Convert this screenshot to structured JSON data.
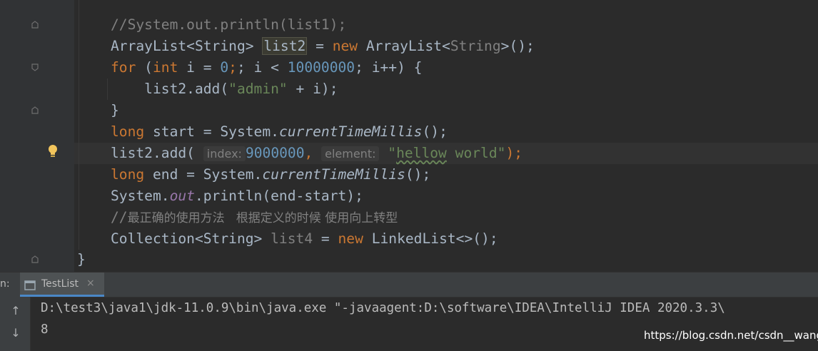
{
  "code": {
    "l1_comment": "//System.out.println(list1);",
    "l2_type": "ArrayList<String> ",
    "l2_var": "list2",
    "l2_eq": " = ",
    "l2_new": "new",
    "l2_cls": " ArrayList<",
    "l2_generic": "String",
    "l2_end": ">();",
    "l3_for": "for",
    "l3_a": " (",
    "l3_int": "int",
    "l3_b": " i = ",
    "l3_zero": "0",
    "l3_c": "; i < ",
    "l3_limit": "10000000",
    "l3_d": "; i++) {",
    "l4_a": "    list2.add(",
    "l4_str": "\"admin\"",
    "l4_b": " + i);",
    "l5_brace": "}",
    "l6_long": "long",
    "l6_a": " start = System.",
    "l6_method": "currentTimeMillis",
    "l6_b": "();",
    "l7_a": "list2.add(",
    "l7_hint_index": "index:",
    "l7_index_val": "9000000",
    "l7_comma": ", ",
    "l7_hint_element": "element:",
    "l7_str_q1": "\"",
    "l7_str_word": "hellow",
    "l7_str_rest": " world\"",
    "l7_end": ");",
    "l8_long": "long",
    "l8_a": " end = System.",
    "l8_method": "currentTimeMillis",
    "l8_b": "();",
    "l9_a": "System.",
    "l9_field": "out",
    "l9_b": ".println(end-start);",
    "l10_comment_slashes": "//",
    "l10_comment_text": "最正确的使用方法   根据定义的时候 使用向上转型",
    "l11_a": "Collection<String> ",
    "l11_var": "list4",
    "l11_eq": " = ",
    "l11_new": "new",
    "l11_b": " LinkedList<>();",
    "l12_brace": "}"
  },
  "run_panel": {
    "label": "n:",
    "tab_label": "TestList",
    "tab_close": "×",
    "up_arrow": "↑",
    "down_arrow": "↓",
    "console_line_1": "D:\\test3\\java1\\jdk-11.0.9\\bin\\java.exe \"-javaagent:D:\\software\\IDEA\\IntelliJ IDEA 2020.3.3\\",
    "console_line_2": "8"
  },
  "watermark": "https://blog.csdn.net/csdn__wang",
  "icons": [
    "fold-marker-icon",
    "lightbulb-icon",
    "console-tab-icon",
    "close-icon",
    "scroll-up-icon",
    "scroll-down-icon"
  ],
  "colors": {
    "background": "#2b2b2b",
    "keyword": "#cc7832",
    "number": "#6897bb",
    "string": "#6a8759",
    "comment": "#808080",
    "text": "#a9b7c6",
    "field": "#9876aa"
  }
}
